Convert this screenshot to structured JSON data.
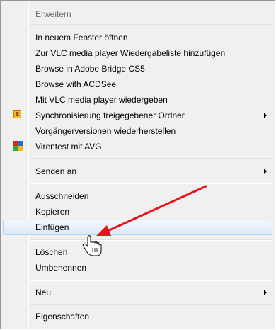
{
  "context_menu": {
    "items": [
      {
        "label": "Erweitern",
        "disabled": true
      },
      {
        "label": "In neuem Fenster öffnen"
      },
      {
        "label": "Zur VLC media player Wiedergabeliste hinzufügen"
      },
      {
        "label": "Browse in Adobe Bridge CS5"
      },
      {
        "label": "Browse with ACDSee"
      },
      {
        "label": "Mit VLC media player wiedergeben"
      },
      {
        "label": "Synchronisierung freigegebener Ordner",
        "icon": "sync-folder-icon",
        "submenu": true
      },
      {
        "label": "Vorgängerversionen wiederherstellen"
      },
      {
        "label": "Virentest mit AVG",
        "icon": "avg-icon"
      },
      {
        "label": "Senden an",
        "submenu": true
      },
      {
        "label": "Ausschneiden"
      },
      {
        "label": "Kopieren"
      },
      {
        "label": "Einfügen",
        "highlighted": true
      },
      {
        "label": "Löschen"
      },
      {
        "label": "Umbenennen"
      },
      {
        "label": "Neu",
        "submenu": true
      },
      {
        "label": "Eigenschaften"
      }
    ]
  },
  "annotation": {
    "arrow_color": "#e8141b",
    "cursor": "hand-cursor-icon"
  },
  "colors": {
    "menu_bg": "#f0f0f0",
    "highlight_border": "#a8d8f8"
  }
}
